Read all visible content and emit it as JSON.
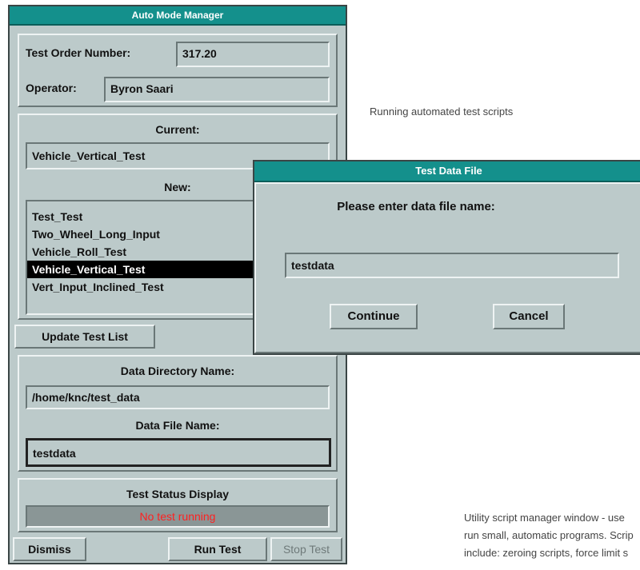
{
  "main_window": {
    "title": "Auto Mode Manager",
    "test_order_label": "Test Order Number:",
    "test_order_value": "317.20",
    "operator_label": "Operator:",
    "operator_value": "Byron Saari",
    "current_label": "Current:",
    "current_value": "Vehicle_Vertical_Test",
    "new_label": "New:",
    "tests": [
      {
        "label": "Test_Test",
        "selected": false
      },
      {
        "label": "Two_Wheel_Long_Input",
        "selected": false
      },
      {
        "label": "Vehicle_Roll_Test",
        "selected": false
      },
      {
        "label": "Vehicle_Vertical_Test",
        "selected": true
      },
      {
        "label": "Vert_Input_Inclined_Test",
        "selected": false
      }
    ],
    "update_button": "Update Test List",
    "data_dir_label": "Data Directory Name:",
    "data_dir_value": "/home/knc/test_data",
    "data_file_label": "Data File Name:",
    "data_file_value": "testdata",
    "status_label": "Test Status Display",
    "status_value": "No test running",
    "status_color": "#ff2020",
    "dismiss_button": "Dismiss",
    "run_button": "Run Test",
    "stop_button": "Stop Test"
  },
  "dialog": {
    "title": "Test Data File",
    "prompt": "Please enter data file name:",
    "input_value": "testdata",
    "continue_button": "Continue",
    "cancel_button": "Cancel"
  },
  "captions": {
    "running": "Running automated test scripts",
    "utility_line1": "Utility script manager window - use",
    "utility_line2": "run small, automatic programs. Scrip",
    "utility_line3": "include: zeroing scripts, force limit s"
  },
  "colors": {
    "title_bar": "#14908c",
    "window_bg": "#bccaca"
  }
}
